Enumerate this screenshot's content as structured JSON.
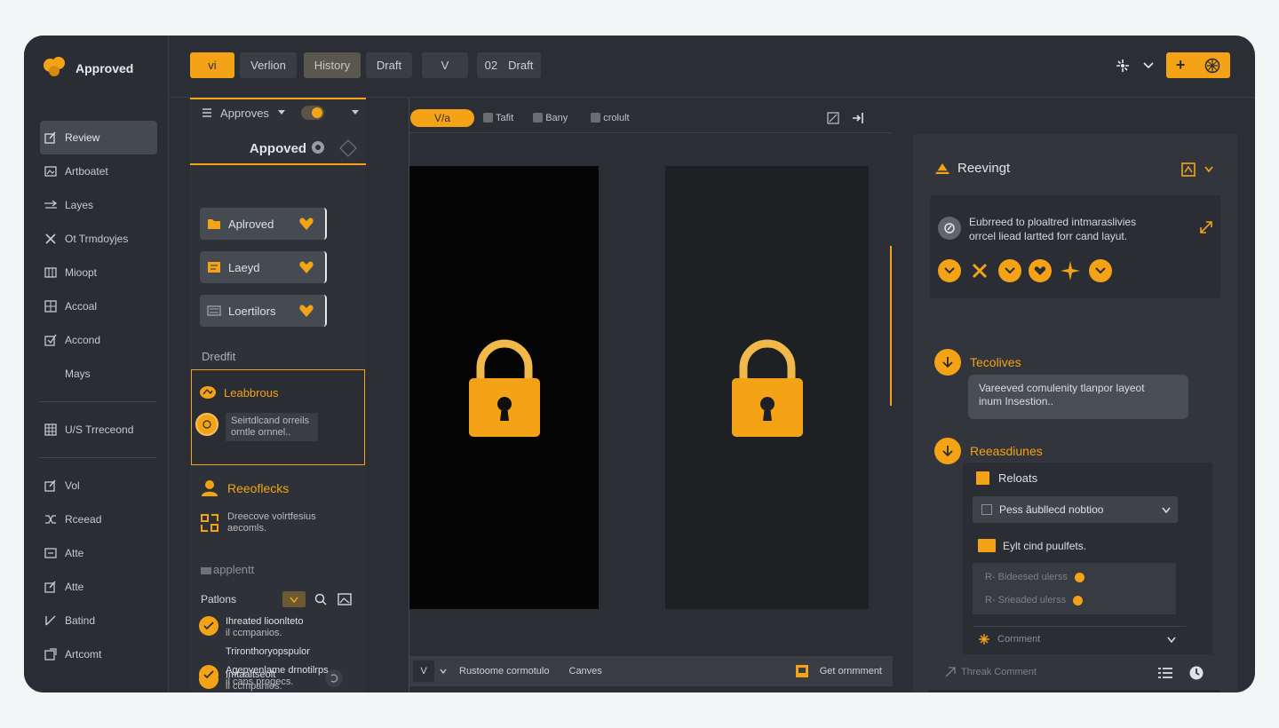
{
  "brand": {
    "name": "Approved"
  },
  "sidebar": {
    "items": [
      {
        "label": "Review",
        "icon": "edit-icon",
        "active": true
      },
      {
        "label": "Artboatet",
        "icon": "image-icon"
      },
      {
        "label": "Layes",
        "icon": "arrows-icon"
      },
      {
        "label": "Ot Trmdoyjes",
        "icon": "close-icon"
      },
      {
        "label": "Mioopt",
        "icon": "panel-icon"
      },
      {
        "label": "Accoal",
        "icon": "grid-icon"
      },
      {
        "label": "Accond",
        "icon": "checkbox-icon"
      },
      {
        "label": "Mays",
        "icon": ""
      },
      {
        "label": "U/S Trreceond",
        "icon": "table-icon"
      },
      {
        "label": "Vol",
        "icon": "edit-icon"
      },
      {
        "label": "Rceead",
        "icon": "shuffle-icon"
      },
      {
        "label": "Atte",
        "icon": "list-icon"
      },
      {
        "label": "Atte",
        "icon": "edit-icon"
      },
      {
        "label": "Batind",
        "icon": "pencil-icon"
      },
      {
        "label": "Artcomt",
        "icon": "external-icon"
      }
    ]
  },
  "topbar": {
    "tabs": [
      "vi",
      "Verlion",
      "History",
      "Draft",
      "V",
      "02",
      "Draft"
    ]
  },
  "left_panel": {
    "header": "Approves",
    "title": "Appoved",
    "cards": [
      "Aplroved",
      "Laeyd",
      "Loertilors"
    ],
    "section1": "Dredfit",
    "highlight": {
      "title": "Leabbrous",
      "text1": "Seirtdlcand orreils",
      "text2": "orntle ornnel.."
    },
    "reorders": {
      "title": "Reeoflecks",
      "text1": "Dreecove volrtfesius",
      "text2": "aecomls."
    },
    "section2": "applentt",
    "pations": {
      "label": "Patlons"
    },
    "checks": [
      {
        "text1": "Ihreated lioonlteto",
        "text2": "il ccmpanios."
      },
      {
        "text1": "Trironthoryopspulor",
        "text2": ""
      },
      {
        "text1": "Imtaaitseolt",
        "text2": "il ccmpanios."
      },
      {
        "text1": "Agepvenlame drnotilrps",
        "text2": "il cans progecs."
      }
    ]
  },
  "canvas": {
    "pill": "V/a",
    "checkboxes": [
      "Tafit",
      "Bany",
      "crolult"
    ],
    "bottom": {
      "select": "V",
      "label1": "Rustoome cormotulo",
      "label2": "Canves",
      "comment": "Get ornmment"
    }
  },
  "right_panel": {
    "title": "Reevingt",
    "box_text1": "Eubrreed to ploaltred  intmaraslivies",
    "box_text2": "orrcel liead lartted forr cand layut.",
    "step1": {
      "title": "Tecolives",
      "bubble1": "Vareeved comulenity tlanpor layeot",
      "bubble2": "inum Insestion.."
    },
    "step2": {
      "title": "Reeasdiunes"
    },
    "sub": {
      "heading": "Reloats",
      "select": "Pess ãubllecd nobtioo",
      "option": "Eylt cind puulfets.",
      "rows": [
        "R- Bideesed ulerss",
        "R- Srieaded ulerss"
      ],
      "comment": "Cornment"
    },
    "footer": {
      "label": "Threak  Comment"
    }
  },
  "colors": {
    "accent": "#f5a316",
    "background": "#2b2e35"
  }
}
